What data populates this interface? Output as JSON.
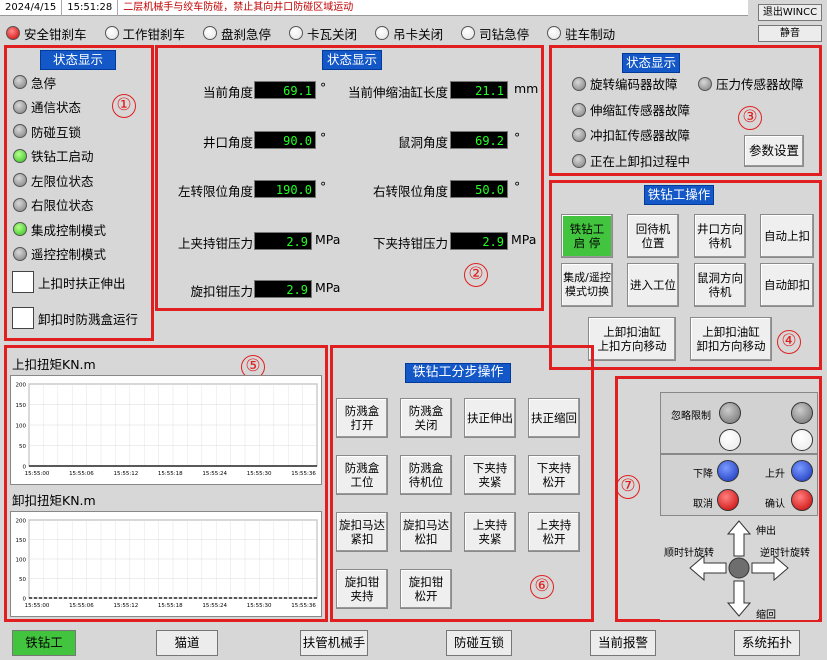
{
  "topbar": {
    "date": "2024/4/15",
    "time": "15:51:28",
    "message": "二层机械手与绞车防碰，禁止其向井口防碰区域运动",
    "exit_label": "退出WINCC",
    "mute_label": "静音"
  },
  "brakes": [
    {
      "label": "安全钳刹车",
      "color": "red"
    },
    {
      "label": "工作钳刹车",
      "color": "white"
    },
    {
      "label": "盘刹急停",
      "color": "white"
    },
    {
      "label": "卡瓦关闭",
      "color": "white"
    },
    {
      "label": "吊卡关闭",
      "color": "white"
    },
    {
      "label": "司钻急停",
      "color": "white"
    },
    {
      "label": "驻车制动",
      "color": "white"
    }
  ],
  "panel1": {
    "title": "状态显示",
    "number": "①",
    "items": [
      {
        "label": "急停",
        "color": "grey"
      },
      {
        "label": "通信状态",
        "color": "grey"
      },
      {
        "label": "防碰互锁",
        "color": "grey"
      },
      {
        "label": "铁钻工启动",
        "color": "green"
      },
      {
        "label": "左限位状态",
        "color": "grey"
      },
      {
        "label": "右限位状态",
        "color": "grey"
      },
      {
        "label": "集成控制模式",
        "color": "green"
      },
      {
        "label": "遥控控制模式",
        "color": "grey"
      }
    ],
    "check1": "上扣时扶正伸出",
    "check2": "卸扣时防溅盒运行"
  },
  "panel2": {
    "title": "状态显示",
    "number": "②",
    "current_angle_label": "当前角度",
    "current_angle": "69.1",
    "deg": "°",
    "cyl_len_label": "当前伸缩油缸长度",
    "cyl_len": "21.1",
    "mm": "mm",
    "well_angle_label": "井口角度",
    "well_angle": "90.0",
    "mouse_angle_label": "鼠洞角度",
    "mouse_angle": "69.2",
    "left_limit_label": "左转限位角度",
    "left_limit": "190.0",
    "right_limit_label": "右转限位角度",
    "right_limit": "50.0",
    "upper_p_label": "上夹持钳压力",
    "upper_p": "2.9",
    "mpa": "MPa",
    "lower_p_label": "下夹持钳压力",
    "lower_p": "2.9",
    "spin_p_label": "旋扣钳压力",
    "spin_p": "2.9"
  },
  "panel3": {
    "title": "状态显示",
    "number": "③",
    "items": [
      {
        "label": "旋转编码器故障",
        "color": "grey"
      },
      {
        "label": "压力传感器故障",
        "color": "grey"
      },
      {
        "label": "伸缩缸传感器故障",
        "color": "grey"
      },
      {
        "label": "冲扣缸传感器故障",
        "color": "grey"
      },
      {
        "label": "正在上卸扣过程中",
        "color": "grey"
      }
    ],
    "param_btn": "参数设置"
  },
  "panel4": {
    "title": "铁钻工操作",
    "number": "④",
    "buttons": [
      "铁钻工\n启 停",
      "回待机\n位置",
      "井口方向\n待机",
      "自动上扣",
      "集成/遥控\n模式切换",
      "进入工位",
      "鼠洞方向\n待机",
      "自动卸扣"
    ],
    "btn_up": "上卸扣油缸\n上扣方向移动",
    "btn_down": "上卸扣油缸\n卸扣方向移动"
  },
  "panel5": {
    "number": "⑤",
    "title1": "上扣扭矩KN.m",
    "title2": "卸扣扭矩KN.m"
  },
  "panel6": {
    "title": "铁钻工分步操作",
    "number": "⑥",
    "buttons": [
      "防溅盒\n打开",
      "防溅盒\n关闭",
      "扶正伸出",
      "扶正缩回",
      "防溅盒\n工位",
      "防溅盒\n待机位",
      "下夹持\n夹紧",
      "下夹持\n松开",
      "旋扣马达\n紧扣",
      "旋扣马达\n松扣",
      "上夹持\n夹紧",
      "上夹持\n松开",
      "旋扣钳\n夹持",
      "旋扣钳\n松开"
    ]
  },
  "panel7": {
    "number": "⑦",
    "ignore_label": "忽略限制",
    "down_label": "下降",
    "up_label": "上升",
    "cancel_label": "取消",
    "confirm_label": "确认",
    "extend_label": "伸出",
    "retract_label": "缩回",
    "ccw_label": "顺时针旋转",
    "cw_label": "逆时针旋转"
  },
  "nav": [
    "铁钻工",
    "猫道",
    "扶管机械手",
    "防碰互锁",
    "当前报警",
    "系统拓扑"
  ],
  "chart_data": [
    {
      "type": "line",
      "title": "上扣扭矩KN.m",
      "x": [
        "15:55:00",
        "15:55:06",
        "15:55:12",
        "15:55:18",
        "15:55:24",
        "15:55:30",
        "15:55:36"
      ],
      "ylim": [
        0,
        200
      ],
      "yticks": [
        0,
        50,
        100,
        150,
        200
      ],
      "series": [
        {
          "values": [
            0,
            0,
            0,
            0,
            0,
            0,
            0
          ]
        }
      ]
    },
    {
      "type": "line",
      "title": "卸扣扭矩KN.m",
      "x": [
        "15:55:00",
        "15:55:06",
        "15:55:12",
        "15:55:18",
        "15:55:24",
        "15:55:30",
        "15:55:36"
      ],
      "ylim": [
        0,
        200
      ],
      "yticks": [
        0,
        50,
        100,
        150,
        200
      ],
      "series": [
        {
          "values": [
            0,
            0,
            0,
            0,
            0,
            0,
            0
          ]
        }
      ]
    }
  ]
}
